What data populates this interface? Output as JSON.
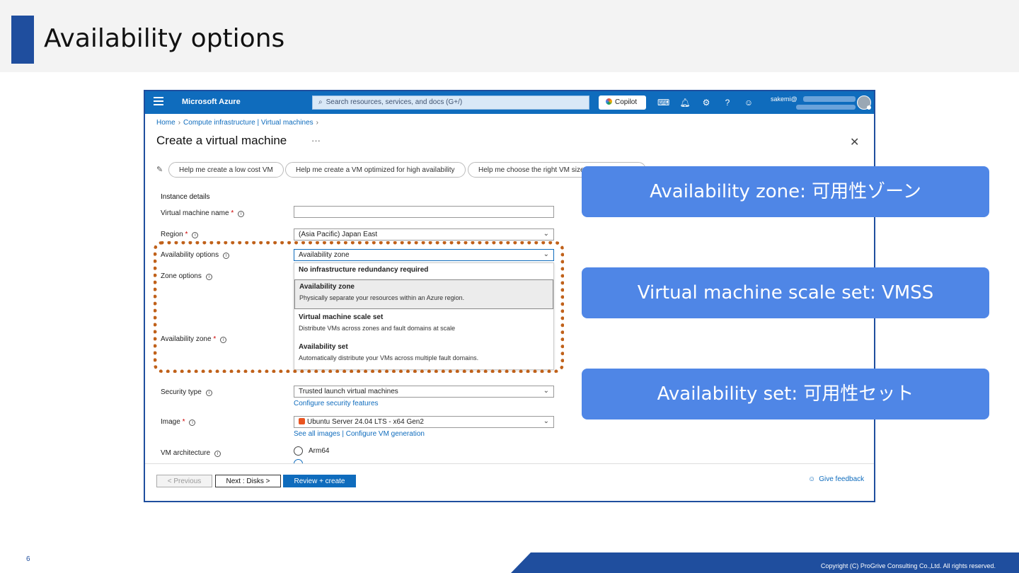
{
  "slide": {
    "title": "Availability options",
    "page_number": "6",
    "copyright": "Copyright (C) ProGrive Consulting Co.,Ltd. All rights reserved."
  },
  "azure": {
    "brand": "Microsoft Azure",
    "search_placeholder": "Search resources, services, and docs (G+/)",
    "copilot": "Copilot",
    "user": "sakemi@",
    "breadcrumb": [
      "Home",
      "Compute infrastructure | Virtual machines"
    ],
    "page_title": "Create a virtual machine",
    "more": "···",
    "suggestions": [
      "Help me create a low cost VM",
      "Help me create a VM optimized for high availability",
      "Help me choose the right VM size"
    ],
    "section": "Instance details",
    "labels": {
      "vm_name": "Virtual machine name",
      "region": "Region",
      "availability_options": "Availability options",
      "zone_options": "Zone options",
      "availability_zone": "Availability zone",
      "security_type": "Security type",
      "image": "Image",
      "vm_architecture": "VM architecture"
    },
    "required_mark": "*",
    "values": {
      "vm_name": "",
      "region": "(Asia Pacific) Japan East",
      "availability_options": "Availability zone",
      "security_type": "Trusted launch virtual machines",
      "image": "Ubuntu Server 24.04 LTS - x64 Gen2"
    },
    "links": {
      "configure_security": "Configure security features",
      "see_all_images": "See all images",
      "link_sep": "|",
      "configure_vm_gen": "Configure VM generation"
    },
    "dropdown_options": [
      {
        "title": "No infrastructure redundancy required",
        "desc": ""
      },
      {
        "title": "Availability zone",
        "desc": "Physically separate your resources within an Azure region."
      },
      {
        "title": "Virtual machine scale set",
        "desc": "Distribute VMs across zones and fault domains at scale"
      },
      {
        "title": "Availability set",
        "desc": "Automatically distribute your VMs across multiple fault domains."
      }
    ],
    "architecture_options": [
      "Arm64"
    ],
    "buttons": {
      "previous": "< Previous",
      "next": "Next : Disks >",
      "review": "Review + create",
      "feedback": "Give feedback"
    }
  },
  "callouts": [
    "Availability zone: 可用性ゾーン",
    "Virtual machine scale set: VMSS",
    "Availability set: 可用性セット"
  ],
  "colors": {
    "accent": "#1f4e9e",
    "azure_blue": "#0f6cbd",
    "callout": "#4f86e6",
    "highlight_border": "#c0611a"
  }
}
